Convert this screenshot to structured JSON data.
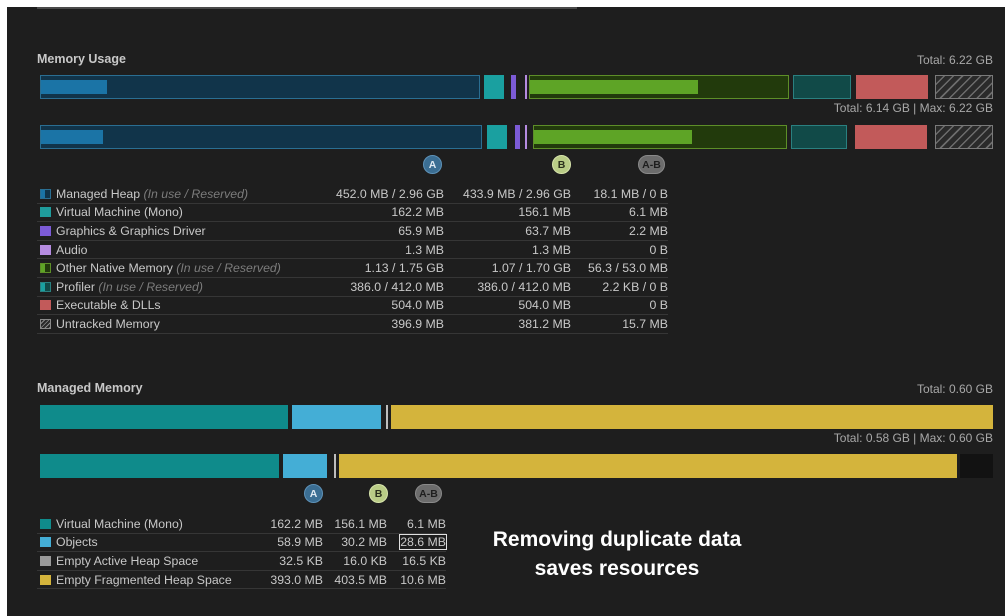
{
  "memory_usage": {
    "title": "Memory Usage",
    "total_top": "Total: 6.22 GB",
    "total_bottom": "Total: 6.14 GB | Max: 6.22 GB",
    "badges": {
      "a": "A",
      "b": "B",
      "ab": "A-B"
    },
    "rows": [
      {
        "label": "Managed Heap",
        "note": "(In use / Reserved)",
        "a": "452.0 MB / 2.96 GB",
        "b": "433.9 MB / 2.96 GB",
        "diff": "18.1 MB / 0 B",
        "swatch": "split-blue"
      },
      {
        "label": "Virtual Machine (Mono)",
        "note": "",
        "a": "162.2 MB",
        "b": "156.1 MB",
        "diff": "6.1 MB",
        "swatch": "#1f9c9c"
      },
      {
        "label": "Graphics & Graphics Driver",
        "note": "",
        "a": "65.9 MB",
        "b": "63.7 MB",
        "diff": "2.2 MB",
        "swatch": "#7c5bd6"
      },
      {
        "label": "Audio",
        "note": "",
        "a": "1.3 MB",
        "b": "1.3 MB",
        "diff": "0 B",
        "swatch": "#b58be0"
      },
      {
        "label": "Other Native Memory",
        "note": "(In use / Reserved)",
        "a": "1.13 / 1.75 GB",
        "b": "1.07 / 1.70 GB",
        "diff": "56.3 / 53.0 MB",
        "swatch": "split-green"
      },
      {
        "label": "Profiler",
        "note": "(In use / Reserved)",
        "a": "386.0 / 412.0 MB",
        "b": "386.0 / 412.0 MB",
        "diff": "2.2 KB / 0 B",
        "swatch": "split-teal"
      },
      {
        "label": "Executable & DLLs",
        "note": "",
        "a": "504.0 MB",
        "b": "504.0 MB",
        "diff": "0 B",
        "swatch": "#c25a5a"
      },
      {
        "label": "Untracked Memory",
        "note": "",
        "a": "396.9 MB",
        "b": "381.2 MB",
        "diff": "15.7 MB",
        "swatch": "hatch"
      }
    ]
  },
  "managed_memory": {
    "title": "Managed Memory",
    "total_top": "Total: 0.60 GB",
    "total_bottom": "Total: 0.58 GB | Max: 0.60 GB",
    "badges": {
      "a": "A",
      "b": "B",
      "ab": "A-B"
    },
    "rows": [
      {
        "label": "Virtual Machine (Mono)",
        "a": "162.2 MB",
        "b": "156.1 MB",
        "diff": "6.1 MB",
        "swatch": "#0f8b8b"
      },
      {
        "label": "Objects",
        "a": "58.9 MB",
        "b": "30.2 MB",
        "diff": "28.6 MB",
        "swatch": "#44aed6"
      },
      {
        "label": "Empty Active Heap Space",
        "a": "32.5 KB",
        "b": "16.0 KB",
        "diff": "16.5 KB",
        "swatch": "#9a9a9a"
      },
      {
        "label": "Empty Fragmented Heap Space",
        "a": "393.0 MB",
        "b": "403.5 MB",
        "diff": "10.6 MB",
        "swatch": "#d4b43c"
      }
    ]
  },
  "callout": {
    "line1": "Removing duplicate data",
    "line2": "saves resources"
  }
}
